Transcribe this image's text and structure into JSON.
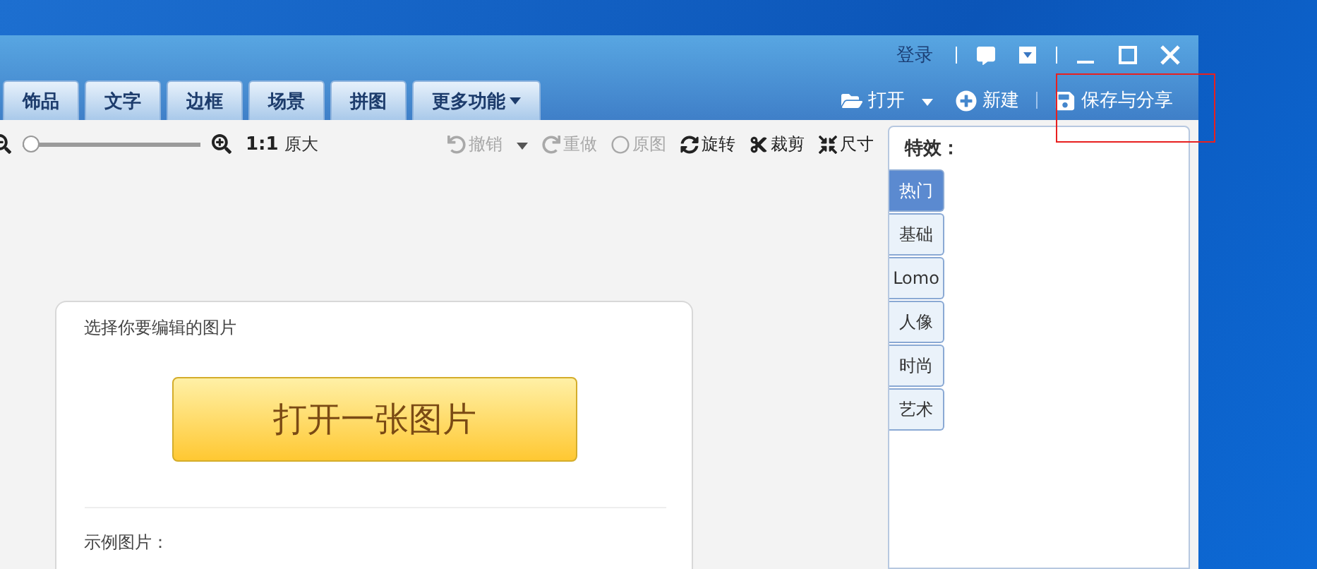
{
  "title_bar": {
    "login": "登录"
  },
  "tabs": [
    {
      "label": "饰品",
      "selected": false
    },
    {
      "label": "文字",
      "selected": false
    },
    {
      "label": "边框",
      "selected": false
    },
    {
      "label": "场景",
      "selected": false
    },
    {
      "label": "拼图",
      "selected": false
    },
    {
      "label": "更多功能",
      "selected": false,
      "dropdown": true
    }
  ],
  "actions": [
    {
      "label": "打开",
      "dropdown": true
    },
    {
      "label": "新建",
      "dropdown": false
    },
    {
      "label": "保存与分享",
      "dropdown": false,
      "highlighted": true
    }
  ],
  "zoom": {
    "level": 0,
    "ratio": "1:1",
    "ratio_label": "原大"
  },
  "edit_tools": [
    {
      "label": "撤销",
      "disabled": true,
      "dropdown": true
    },
    {
      "label": "重做",
      "disabled": true,
      "dropdown": false
    },
    {
      "label": "原图",
      "disabled": true,
      "dropdown": false
    },
    {
      "label": "旋转",
      "disabled": false,
      "dropdown": false
    },
    {
      "label": "裁剪",
      "disabled": false,
      "dropdown": false
    },
    {
      "label": "尺寸",
      "disabled": false,
      "dropdown": false
    }
  ],
  "open_card": {
    "prompt": "选择你要编辑的图片",
    "button": "打开一张图片",
    "samples_label": "示例图片："
  },
  "effects": {
    "title": "特效：",
    "tabs": [
      {
        "label": "热门",
        "selected": true
      },
      {
        "label": "基础",
        "selected": false
      },
      {
        "label": "Lomo",
        "selected": false
      },
      {
        "label": "人像",
        "selected": false
      },
      {
        "label": "时尚",
        "selected": false
      },
      {
        "label": "艺术",
        "selected": false
      }
    ]
  }
}
